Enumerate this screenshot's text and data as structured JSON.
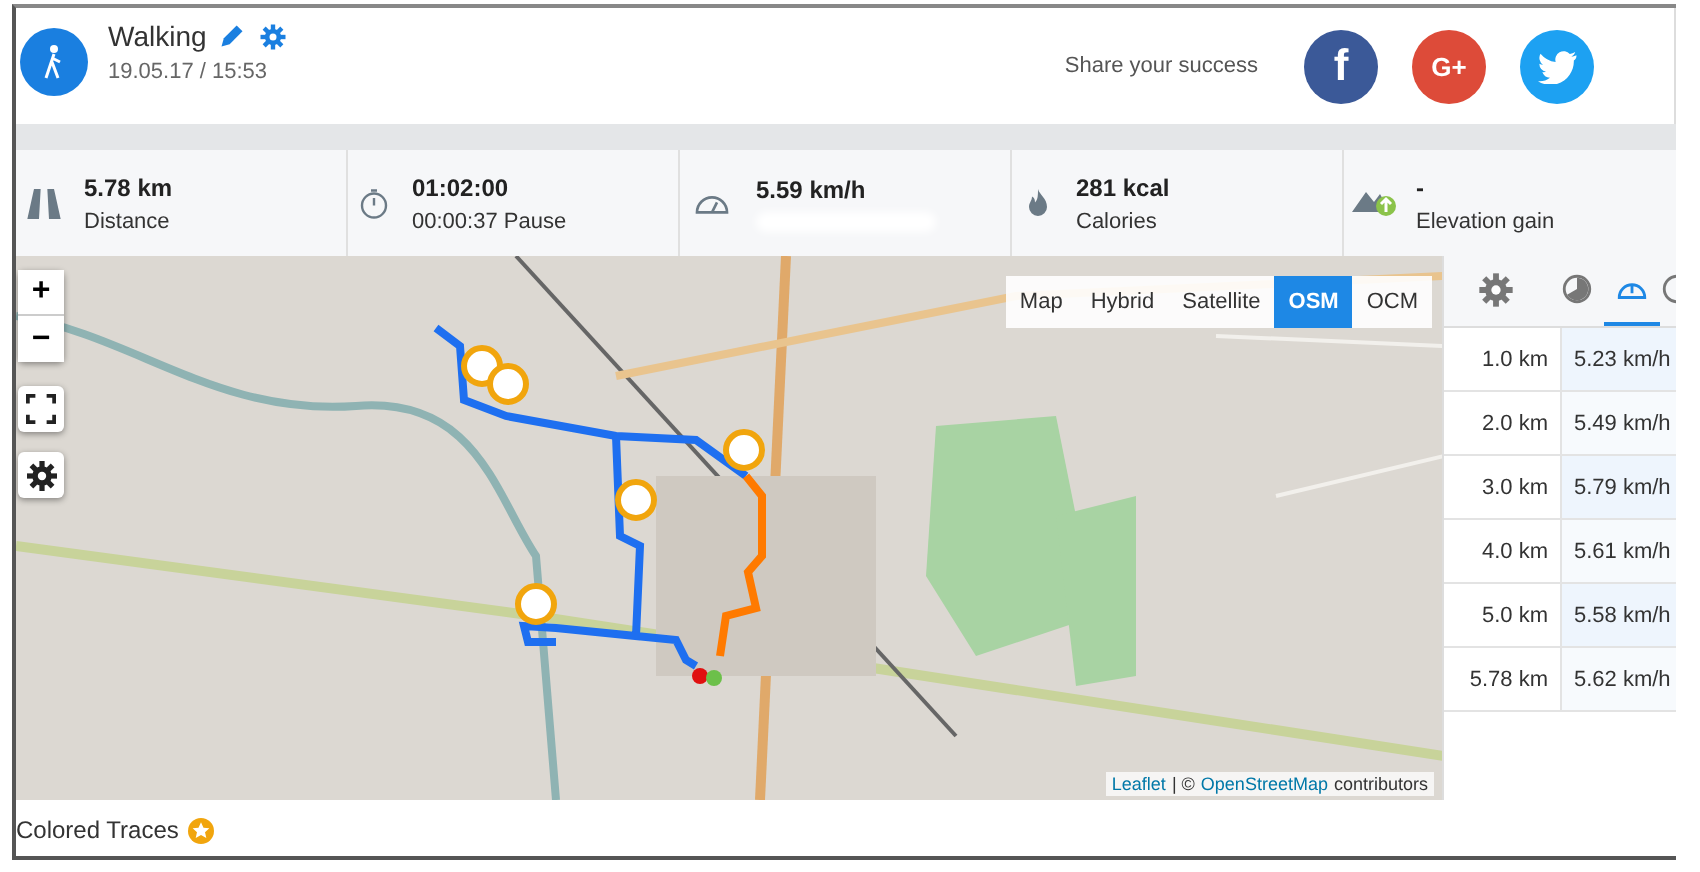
{
  "activity": {
    "title": "Walking",
    "datetime": "19.05.17 / 15:53"
  },
  "share": {
    "label": "Share your success",
    "buttons": [
      {
        "kind": "facebook",
        "label": "f"
      },
      {
        "kind": "google",
        "label": "G+"
      },
      {
        "kind": "twitter"
      }
    ]
  },
  "stats": [
    {
      "kind": "road",
      "value": "5.78 km",
      "label": "Distance"
    },
    {
      "kind": "timer",
      "value": "01:02:00",
      "label": "00:00:37 Pause"
    },
    {
      "kind": "speed",
      "value": "5.59 km/h"
    },
    {
      "kind": "calories",
      "value": "281 kcal",
      "label": "Calories"
    },
    {
      "kind": "elevation",
      "value": "-",
      "label": "Elevation gain"
    }
  ],
  "map": {
    "zoom_buttons": [
      "+",
      "−"
    ],
    "layers": [
      {
        "label": "Map",
        "selected": false
      },
      {
        "label": "Hybrid",
        "selected": false
      },
      {
        "label": "Satellite",
        "selected": false
      },
      {
        "label": "OSM",
        "selected": true
      },
      {
        "label": "OCM",
        "selected": false
      }
    ],
    "attribution": {
      "link_1": "Leaflet",
      "separator": "| ©",
      "link_2": "OpenStreetMap",
      "text": "contributors"
    }
  },
  "splits": {
    "tabs": [
      {
        "kind": "settings",
        "selected": false
      },
      {
        "kind": "pie",
        "selected": false
      },
      {
        "kind": "speed",
        "selected": true
      },
      {
        "kind": "clock",
        "selected": false
      }
    ],
    "rows": [
      {
        "distance": "1.0 km",
        "speed": "5.23 km/h"
      },
      {
        "distance": "2.0 km",
        "speed": "5.49 km/h"
      },
      {
        "distance": "3.0 km",
        "speed": "5.79 km/h"
      },
      {
        "distance": "4.0 km",
        "speed": "5.61 km/h"
      },
      {
        "distance": "5.0 km",
        "speed": "5.58 km/h"
      },
      {
        "distance": "5.78 km",
        "speed": "5.62 km/h"
      }
    ]
  },
  "footer": {
    "label": "Colored Traces"
  }
}
